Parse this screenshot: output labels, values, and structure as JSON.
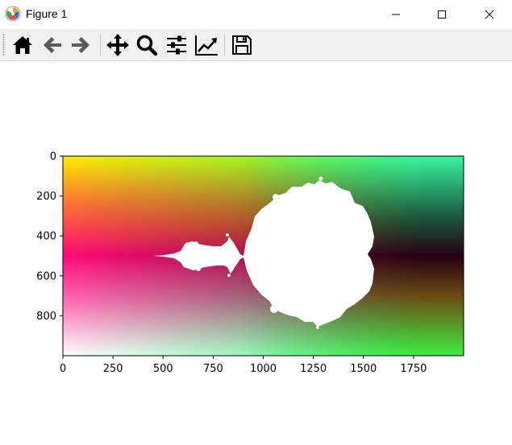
{
  "window": {
    "title": "Figure 1",
    "controls": [
      "minimize",
      "maximize",
      "close"
    ]
  },
  "toolbar": {
    "buttons": [
      {
        "name": "home",
        "icon": "home-icon"
      },
      {
        "name": "back",
        "icon": "arrow-left-icon"
      },
      {
        "name": "forward",
        "icon": "arrow-right-icon"
      },
      {
        "name": "pan",
        "icon": "move-icon"
      },
      {
        "name": "zoom",
        "icon": "magnifier-icon"
      },
      {
        "name": "configure-subplots",
        "icon": "sliders-icon"
      },
      {
        "name": "edit-axes",
        "icon": "line-chart-icon"
      },
      {
        "name": "save",
        "icon": "floppy-disk-icon"
      }
    ]
  },
  "chart_data": {
    "type": "heatmap",
    "description_of_content": "image",
    "x_ticks": [
      "0",
      "250",
      "500",
      "750",
      "1000",
      "1250",
      "1500",
      "1750"
    ],
    "y_ticks": [
      "0",
      "200",
      "400",
      "600",
      "800"
    ],
    "xlim": [
      0,
      2000
    ],
    "ylim": [
      1000,
      0
    ],
    "image_width": 2000,
    "image_height": 1000,
    "title": "",
    "xlabel": "",
    "ylabel": ""
  }
}
